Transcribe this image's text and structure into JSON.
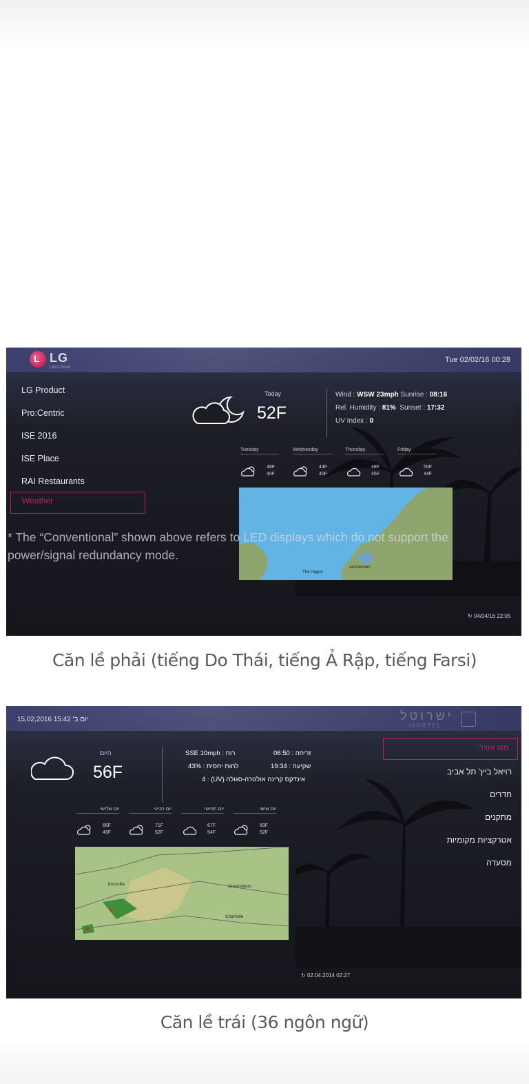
{
  "screen1": {
    "logo_text": "LG",
    "logo_tagline": "Life's Good",
    "datetime": "Tue 02/02/16 00:28",
    "menu": [
      "LG Product",
      "Pro:Centric",
      "ISE 2016",
      "ISE Place",
      "RAI Restaurants",
      "Weather"
    ],
    "today_label": "Today",
    "temp": "52F",
    "wind_label": "Wind : ",
    "wind_value": "WSW 23mph",
    "sunrise_label": "Sunrise : ",
    "sunrise_value": "08:16",
    "humidity_label": "Rel. Humidity : ",
    "humidity_value": "81%",
    "sunset_label": "Sunset : ",
    "sunset_value": "17:32",
    "uv_label": "UV Index : ",
    "uv_value": "0",
    "forecast": [
      {
        "day": "Tuesday",
        "hi": "48F",
        "lo": "40F",
        "icon": "partly-cloudy-sun-icon"
      },
      {
        "day": "Wednesday",
        "hi": "44F",
        "lo": "40F",
        "icon": "partly-cloudy-sun-icon"
      },
      {
        "day": "Thursday",
        "hi": "48F",
        "lo": "45F",
        "icon": "cloud-icon"
      },
      {
        "day": "Friday",
        "hi": "50F",
        "lo": "44F",
        "icon": "cloud-icon"
      }
    ],
    "map_labels": [
      "The Hague",
      "Amsterdam"
    ],
    "refresh_time": "04/04/16 22:05"
  },
  "overlay_note": "* The “Conventional” shown above refers to LED displays which do not support the power/signal redundancy mode.",
  "caption1": "Căn lề phải (tiếng Do Thái, tiếng Ả Rập, tiếng Farsi)",
  "screen2": {
    "datetime": "יום ב' 15:42 15,02,2016",
    "logo_text": "ישרוטל",
    "logo_sub": "ISROTEL",
    "menu": [
      "מזג אוויר",
      "רויאל ביץ' תל אביב",
      "חדרים",
      "מתקנים",
      "אטרקציות מקומיות",
      "מסעדה"
    ],
    "today_label": "היום",
    "temp": "56F",
    "wind": "רוח : SSE 10mph",
    "humidity": "לחות יחסית : 43%",
    "uv": "אינדקס קרינה אולטרה-סגולה (UV) : 4",
    "sunrise": "זריחה : 06:50",
    "sunset": "שקיעה : 19:34",
    "forecast": [
      {
        "day": "יום שלישי",
        "hi": "66F",
        "lo": "49F",
        "icon": "partly-cloudy-sun-icon"
      },
      {
        "day": "יום רביעי",
        "hi": "71F",
        "lo": "52F",
        "icon": "partly-cloudy-sun-icon"
      },
      {
        "day": "יום חמישי",
        "hi": "67F",
        "lo": "54F",
        "icon": "cloud-icon"
      },
      {
        "day": "יום שישי",
        "hi": "60F",
        "lo": "52F",
        "icon": "partly-cloudy-sun-icon"
      }
    ],
    "map_labels": [
      "Greensboro",
      "Charlotte",
      "Knoxville"
    ],
    "refresh_time": "02.04.2014 02:27"
  },
  "caption2": "Căn lề trái (36 ngôn ngữ)",
  "colors": {
    "accent": "#c21e5a",
    "map_sea": "#5fb2e3",
    "map_land": "#8aa56b"
  }
}
